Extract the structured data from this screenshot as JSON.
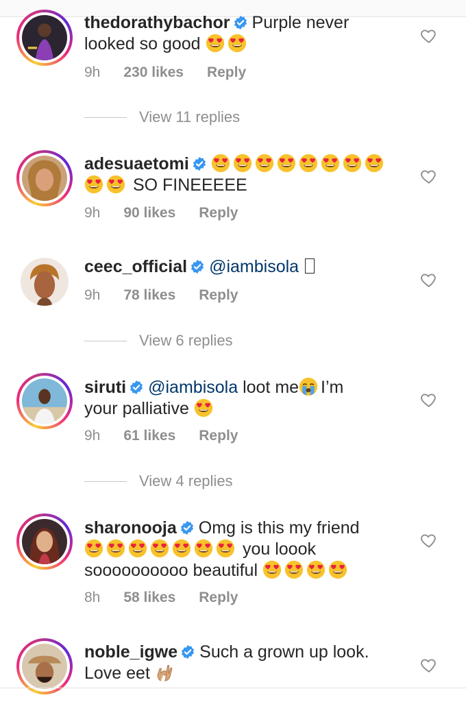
{
  "comments": [
    {
      "username": "thedorathybachor",
      "line1": "Purple never",
      "line2": "looked so good",
      "time": "9h",
      "likes": "230 likes",
      "reply": "Reply"
    },
    {
      "username": "adesuaetomi",
      "line2": "SO FINEEEEE",
      "time": "9h",
      "likes": "90 likes",
      "reply": "Reply"
    },
    {
      "username": "ceec_official",
      "mention": "@iambisola",
      "time": "9h",
      "likes": "78 likes",
      "reply": "Reply"
    },
    {
      "username": "siruti",
      "mention": "@iambisola",
      "line1": "loot me",
      "line1b": "I’m",
      "line2": "your palliative",
      "time": "9h",
      "likes": "61 likes",
      "reply": "Reply"
    },
    {
      "username": "sharonooja",
      "line1": "Omg is this my friend",
      "line2": "you loook",
      "line3": "soooooooooo beautiful",
      "time": "8h",
      "likes": "58 likes",
      "reply": "Reply"
    },
    {
      "username": "noble_igwe",
      "line1": "Such a grown up look.",
      "line2": "Love eet"
    }
  ],
  "view_replies": [
    "View 11 replies",
    "View 6 replies",
    "View 4 replies"
  ],
  "icons": {
    "heart": "heart-outline-icon",
    "verified": "verified-badge-icon",
    "emoji": "heart-eyes-emoji",
    "cry": "crying-emoji",
    "ok": "ok-hand-emoji"
  },
  "colors": {
    "mention": "#00376b",
    "verified": "#3897f0",
    "muted": "#8e8e8e"
  }
}
